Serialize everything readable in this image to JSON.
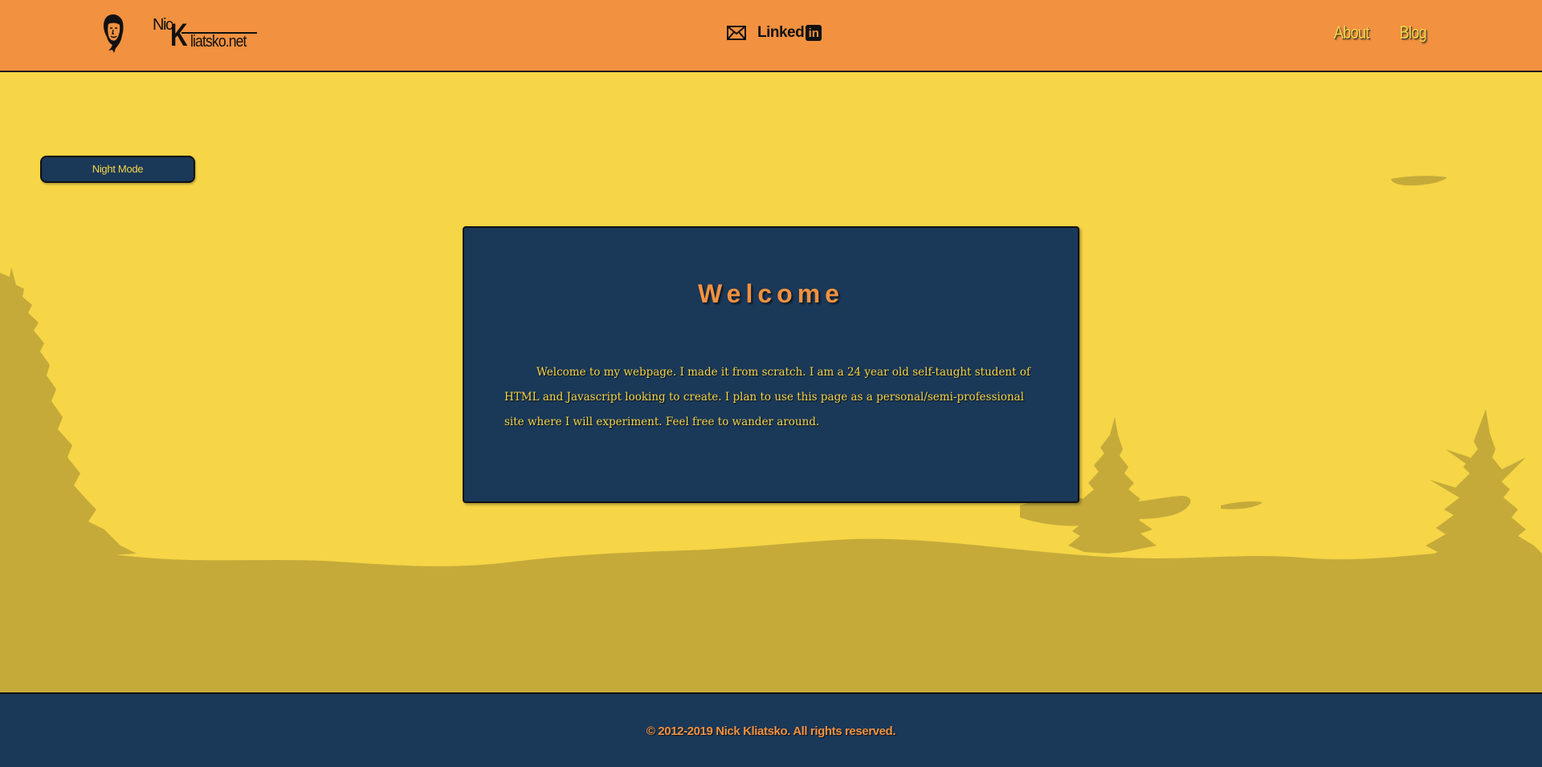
{
  "header": {
    "logo": {
      "nic": "Nic",
      "k": "K",
      "rest": "liatsko.net"
    },
    "contact": {
      "mail_icon": "envelope-icon",
      "linkedin_text": "Linked",
      "linkedin_badge": "in"
    },
    "nav": [
      {
        "label": "About"
      },
      {
        "label": "Blog"
      }
    ]
  },
  "night_mode_button": "Night Mode",
  "welcome": {
    "title": "Welcome",
    "body": "Welcome to my webpage. I made it from scratch. I am a 24 year old self-taught student of HTML and Javascript looking to create. I plan to use this page as a personal/semi-professional site where I will experiment. Feel free to wander around."
  },
  "footer": {
    "copyright": "© 2012-2019 Nick Kliatsko. All rights reserved."
  },
  "colors": {
    "header_bg": "#f29140",
    "page_bg": "#f6d546",
    "scenery": "#c5aa3a",
    "card_bg": "#1a3858",
    "accent_text": "#f6d546",
    "title_text": "#f29140"
  }
}
